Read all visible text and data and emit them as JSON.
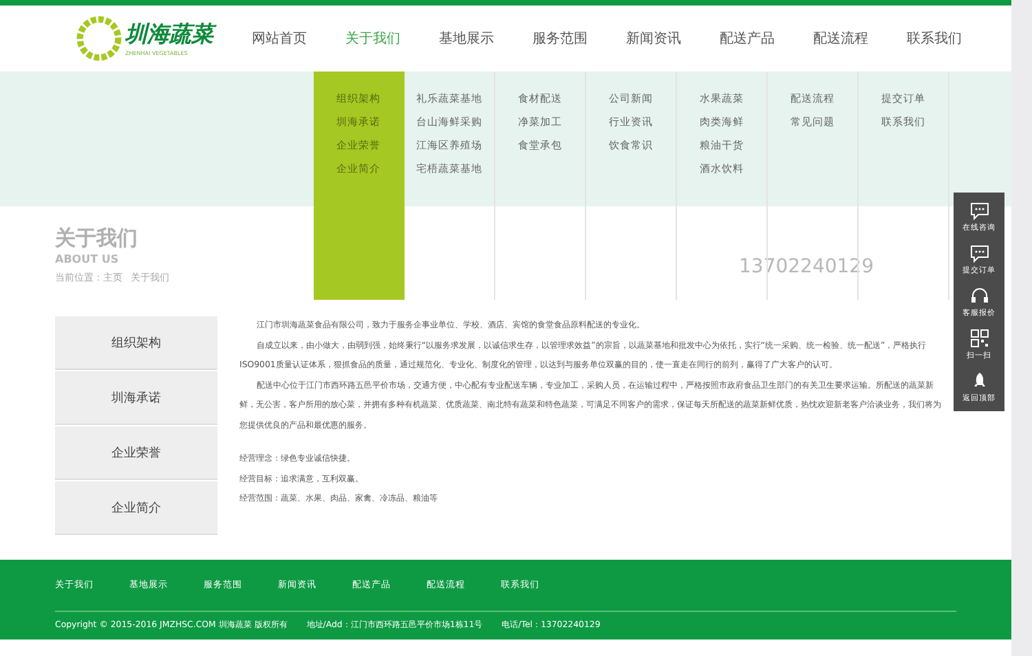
{
  "logo": {
    "name": "圳海蔬菜",
    "subtitle": "ZHENHAI VEGETABLES"
  },
  "nav": [
    {
      "label": "网站首页",
      "selected": false
    },
    {
      "label": "关于我们",
      "selected": true,
      "submenu": [
        "组织架构",
        "圳海承诺",
        "企业荣誉",
        "企业简介"
      ]
    },
    {
      "label": "基地展示",
      "selected": false,
      "submenu": [
        "礼乐蔬菜基地",
        "台山海鲜采购",
        "江海区养殖场",
        "宅梧蔬菜基地"
      ]
    },
    {
      "label": "服务范围",
      "selected": false,
      "submenu": [
        "食材配送",
        "净菜加工",
        "食堂承包"
      ]
    },
    {
      "label": "新闻资讯",
      "selected": false,
      "submenu": [
        "公司新闻",
        "行业资讯",
        "饮食常识"
      ]
    },
    {
      "label": "配送产品",
      "selected": false,
      "submenu": [
        "水果蔬菜",
        "肉类海鲜",
        "粮油干货",
        "酒水饮料"
      ]
    },
    {
      "label": "配送流程",
      "selected": false,
      "submenu": [
        "配送流程",
        "常见问题"
      ]
    },
    {
      "label": "联系我们",
      "selected": false,
      "submenu": [
        "提交订单",
        "联系我们"
      ]
    }
  ],
  "page_title": {
    "title": "关于我们",
    "subtitle": "ABOUT US",
    "breadcrumb": [
      "当前位置：主页",
      "关于我们"
    ],
    "hotline": "13702240129"
  },
  "sidebar": [
    "组织架构",
    "圳海承诺",
    "企业荣誉",
    "企业简介"
  ],
  "paragraphs": [
    "江门市圳海蔬菜食品有限公司，致力于服务企事业单位、学校、酒店、宾馆的食堂食品原料配送的专业化。",
    "自成立以来，由小做大，由弱到强，始终秉行“以服务求发展，以诚信求生存，以管理求效益”的宗旨，以蔬菜基地和批发中心为依托，实行“统一采购、统一检验、统一配送”，严格执行ISO9001质量认证体系，狠抓食品的质量，通过规范化、专业化、制度化的管理，以达到与服务单位双赢的目的，使一直走在同行的前列，赢得了广大客户的认可。",
    "配送中心位于江门市西环路五邑平价市场，交通方便，中心配有专业配送车辆，专业加工，采购人员，在运输过程中，严格按照市政府食品卫生部门的有关卫生要求运输。所配送的蔬菜新鲜，无公害，客户所用的放心菜，并拥有多种有机蔬菜、优质蔬菜、南北特有蔬菜和特色蔬菜，可满足不同客户的需求，保证每天所配送的蔬菜新鲜优质，热忱欢迎新老客户洽谈业务，我们将为您提供优良的产品和最优惠的服务。"
  ],
  "facts": [
    "经营理念：绿色专业诚信快捷。",
    "经营目标：追求满意，互利双赢。",
    "经营范围：蔬菜、水果、肉品、家禽、冷冻品、粮油等"
  ],
  "float_bar": [
    {
      "kind": "chat",
      "label": "在线咨询"
    },
    {
      "kind": "chat",
      "label": "提交订单"
    },
    {
      "kind": "headset",
      "label": "客服报价"
    },
    {
      "kind": "qr",
      "label": "扫一扫"
    },
    {
      "kind": "rocket",
      "label": "返回顶部"
    }
  ],
  "footer": {
    "links": [
      "关于我们",
      "基地展示",
      "服务范围",
      "新闻资讯",
      "配送产品",
      "配送流程",
      "联系我们"
    ],
    "copyright": "Copyright © 2015-2016 JMZHSC.COM 圳海蔬菜 版权所有",
    "address": "地址/Add：江门市西环路五邑平价市场1栋11号",
    "phone": "电话/Tel：13702240129"
  }
}
